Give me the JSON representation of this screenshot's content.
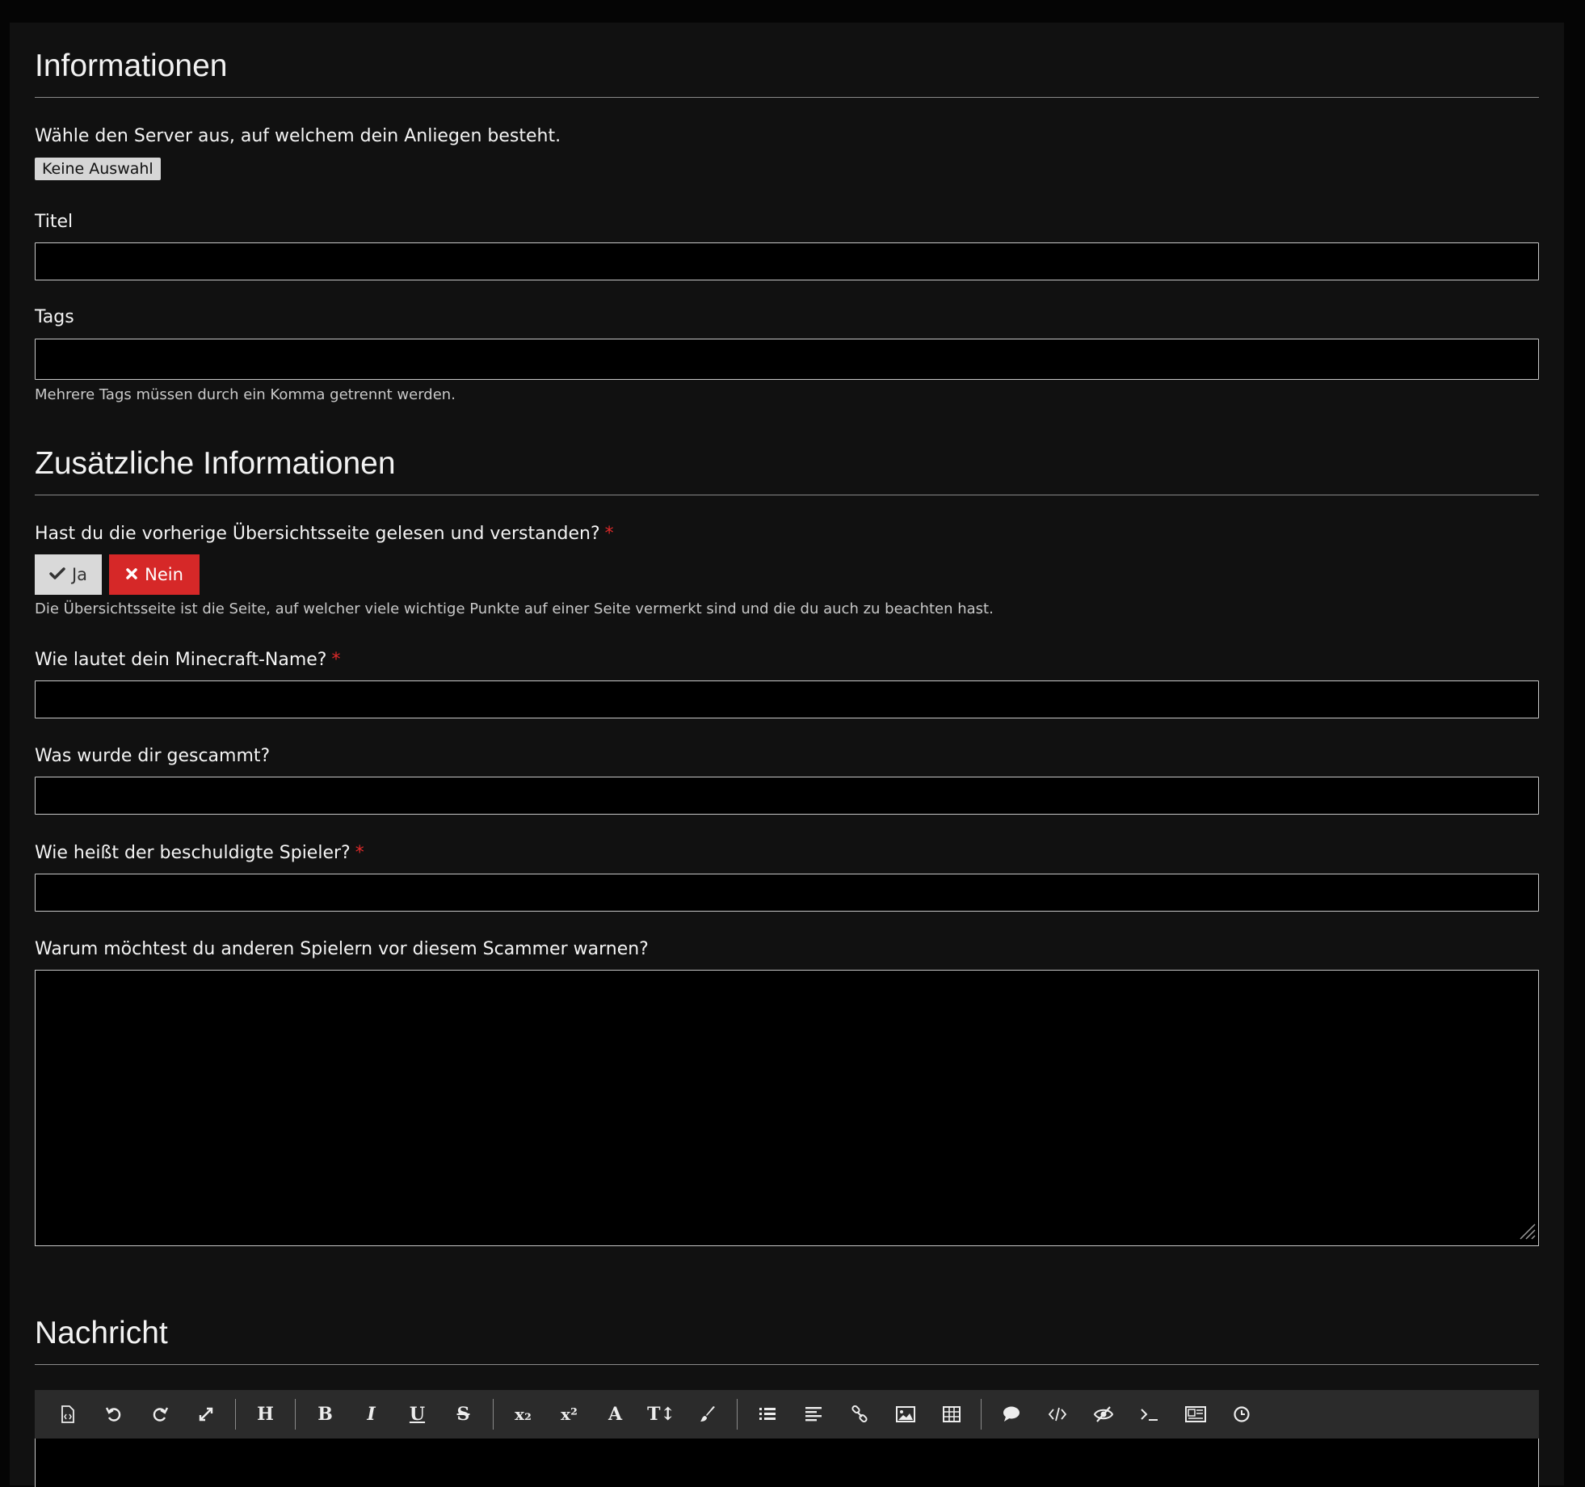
{
  "sections": {
    "info_title": "Informationen",
    "extra_title": "Zusätzliche Informationen",
    "message_title": "Nachricht"
  },
  "server": {
    "label": "Wähle den Server aus, auf welchem dein Anliegen besteht.",
    "selected": "Keine Auswahl"
  },
  "title_field": {
    "label": "Titel",
    "value": ""
  },
  "tags_field": {
    "label": "Tags",
    "value": "",
    "hint": "Mehrere Tags müssen durch ein Komma getrennt werden."
  },
  "question_read": {
    "label": "Hast du die vorherige Übersichtsseite gelesen und verstanden?",
    "required": "*",
    "yes_label": "Ja",
    "no_label": "Nein",
    "hint": "Die Übersichtsseite ist die Seite, auf welcher viele wichtige Punkte auf einer Seite vermerkt sind und die du auch zu beachten hast."
  },
  "question_mcname": {
    "label": "Wie lautet dein Minecraft-Name?",
    "required": "*",
    "value": ""
  },
  "question_scammed": {
    "label": "Was wurde dir gescammt?",
    "value": ""
  },
  "question_accused": {
    "label": "Wie heißt der beschuldigte Spieler?",
    "required": "*",
    "value": ""
  },
  "question_why": {
    "label": "Warum möchtest du anderen Spielern vor diesem Scammer warnen?",
    "value": ""
  },
  "toolbar": {
    "heading_glyph": "H",
    "bold_glyph": "B",
    "italic_glyph": "I",
    "underline_glyph": "U",
    "strike_glyph": "S",
    "sub_glyph": "x₂",
    "sup_glyph": "x²",
    "font_glyph": "A",
    "size_glyph": "T↕",
    "icons": [
      "source-icon",
      "undo-icon",
      "redo-icon",
      "fullscreen-icon",
      "heading-icon",
      "bold-icon",
      "italic-icon",
      "underline-icon",
      "strikethrough-icon",
      "subscript-icon",
      "superscript-icon",
      "font-family-icon",
      "font-size-icon",
      "paint-brush-icon",
      "list-icon",
      "align-icon",
      "link-icon",
      "image-icon",
      "table-icon",
      "quote-icon",
      "code-icon",
      "spoiler-icon",
      "terminal-icon",
      "media-icon",
      "clock-icon"
    ]
  },
  "colors": {
    "background": "#111111",
    "danger": "#d62828",
    "required": "#e02a2a"
  }
}
